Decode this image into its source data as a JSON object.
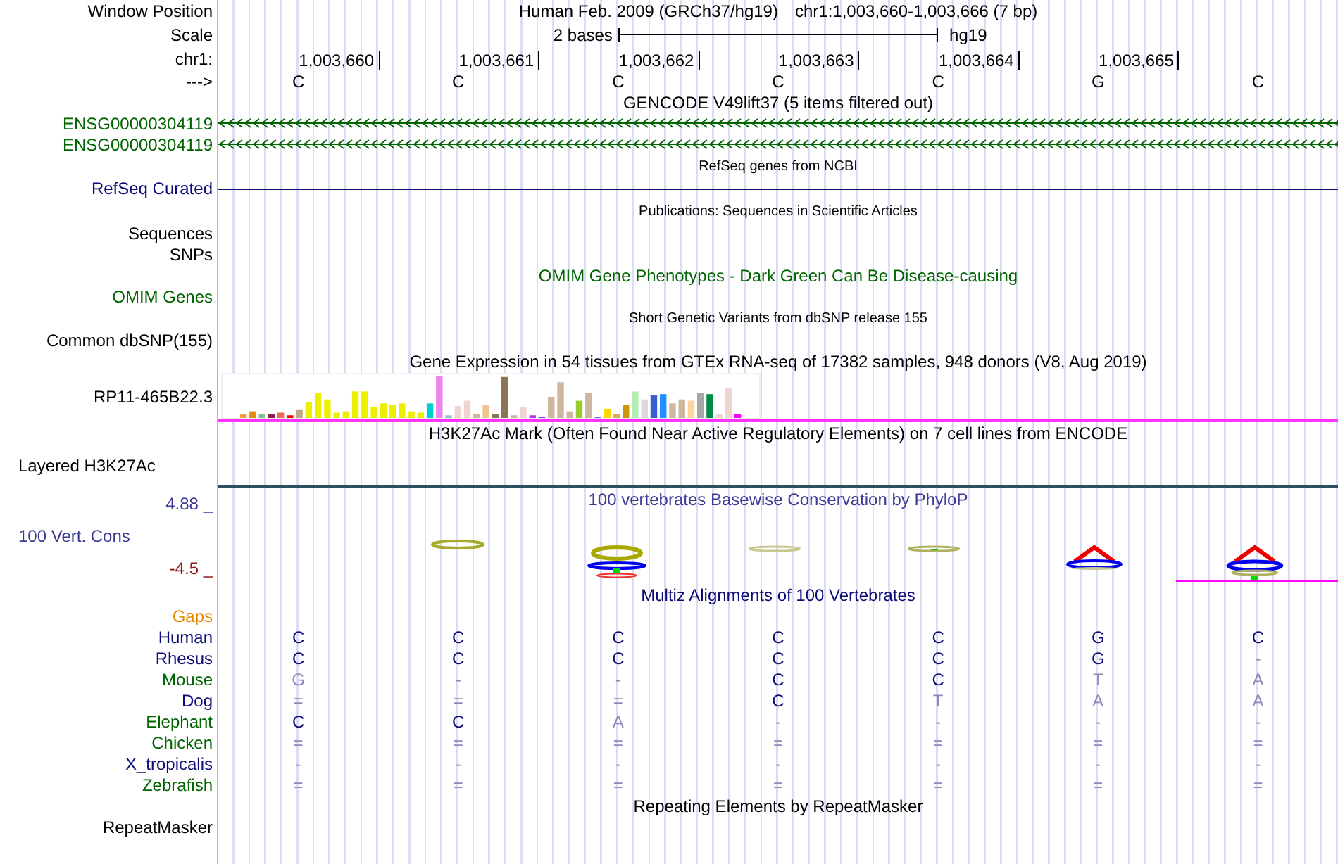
{
  "header": {
    "window_position_label": "Window Position",
    "assembly": "Human Feb. 2009 (GRCh37/hg19)",
    "position": "chr1:1,003,660-1,003,666 (7 bp)",
    "scale_label": "Scale",
    "scale_text": "2 bases",
    "scale_assembly": "hg19",
    "chrom_label": "chr1:",
    "ticks": [
      "1,003,660",
      "1,003,661",
      "1,003,662",
      "1,003,663",
      "1,003,664",
      "1,003,665"
    ],
    "strand_label": "--->",
    "bases": [
      "C",
      "C",
      "C",
      "C",
      "C",
      "G",
      "C"
    ]
  },
  "tracks": [
    {
      "kind": "title",
      "title": "GENCODE V49lift37 (5 items filtered out)",
      "color": "#000000"
    },
    {
      "kind": "gene",
      "label": "ENSG00000304119",
      "color": "#006400"
    },
    {
      "kind": "gene",
      "label": "ENSG00000304119",
      "color": "#006400"
    },
    {
      "kind": "title_small",
      "title": "RefSeq genes from NCBI",
      "color": "#000000"
    },
    {
      "kind": "line",
      "label": "RefSeq Curated",
      "color": "#0c0c78"
    },
    {
      "kind": "title_small",
      "title": "Publications: Sequences in Scientific Articles",
      "color": "#000000"
    },
    {
      "kind": "label",
      "label": "Sequences",
      "color": "#000000"
    },
    {
      "kind": "label",
      "label": "SNPs",
      "color": "#000000"
    },
    {
      "kind": "title",
      "title": "OMIM Gene Phenotypes - Dark Green Can Be Disease-causing",
      "color": "#006400"
    },
    {
      "kind": "label",
      "label": "OMIM Genes",
      "color": "#006400"
    },
    {
      "kind": "title_small",
      "title": "Short Genetic Variants from dbSNP release 155",
      "color": "#000000"
    },
    {
      "kind": "label",
      "label": "Common dbSNP(155)",
      "color": "#000000"
    },
    {
      "kind": "title",
      "title": "Gene Expression in 54 tissues from GTEx RNA-seq of 17382 samples, 948 donors (V8, Aug 2019)",
      "color": "#000000"
    },
    {
      "kind": "expression",
      "label": "RP11-465B22.3",
      "color": "#000000"
    },
    {
      "kind": "title",
      "title": "H3K27Ac Mark (Often Found Near Active Regulatory Elements) on 7 cell lines from ENCODE",
      "color": "#000000"
    },
    {
      "kind": "signal",
      "label": "Layered H3K27Ac",
      "color": "#000000"
    },
    {
      "kind": "conservation",
      "max": "4.88 _",
      "label": "100 Vert. Cons",
      "min": "-4.5 _",
      "title": "100 vertebrates Basewise Conservation by PhyloP",
      "color": "#3c3c96"
    },
    {
      "kind": "title",
      "title": "Multiz Alignments of 100 Vertebrates",
      "color": "#0c0c78"
    },
    {
      "kind": "label",
      "label": "Gaps",
      "color": "#e68a00"
    },
    {
      "kind": "alignment",
      "label": "Human",
      "color": "#0c0c78",
      "cells": [
        {
          "text": "C",
          "match": true
        },
        {
          "text": "C",
          "match": true
        },
        {
          "text": "C",
          "match": true
        },
        {
          "text": "C",
          "match": true
        },
        {
          "text": "C",
          "match": true
        },
        {
          "text": "G",
          "match": true
        },
        {
          "text": "C",
          "match": true
        }
      ]
    },
    {
      "kind": "alignment",
      "label": "Rhesus",
      "color": "#0c0c78",
      "cells": [
        {
          "text": "C",
          "match": true
        },
        {
          "text": "C",
          "match": true
        },
        {
          "text": "C",
          "match": true
        },
        {
          "text": "C",
          "match": true
        },
        {
          "text": "C",
          "match": true
        },
        {
          "text": "G",
          "match": true
        },
        {
          "text": "-",
          "match": false
        }
      ]
    },
    {
      "kind": "alignment",
      "label": "Mouse",
      "color": "#006400",
      "cells": [
        {
          "text": "G",
          "match": false
        },
        {
          "text": "-",
          "match": false
        },
        {
          "text": "-",
          "match": false
        },
        {
          "text": "C",
          "match": true
        },
        {
          "text": "C",
          "match": true
        },
        {
          "text": "T",
          "match": false
        },
        {
          "text": "A",
          "match": false
        }
      ]
    },
    {
      "kind": "alignment",
      "label": "Dog",
      "color": "#0c0c78",
      "cells": [
        {
          "text": "=",
          "match": false
        },
        {
          "text": "=",
          "match": false
        },
        {
          "text": "=",
          "match": false
        },
        {
          "text": "C",
          "match": true
        },
        {
          "text": "T",
          "match": false
        },
        {
          "text": "A",
          "match": false
        },
        {
          "text": "A",
          "match": false
        }
      ]
    },
    {
      "kind": "alignment",
      "label": "Elephant",
      "color": "#006400",
      "cells": [
        {
          "text": "C",
          "match": true
        },
        {
          "text": "C",
          "match": true
        },
        {
          "text": "A",
          "match": false
        },
        {
          "text": "-",
          "match": false
        },
        {
          "text": "-",
          "match": false
        },
        {
          "text": "-",
          "match": false
        },
        {
          "text": "-",
          "match": false
        }
      ]
    },
    {
      "kind": "alignment",
      "label": "Chicken",
      "color": "#006400",
      "cells": [
        {
          "text": "=",
          "match": false
        },
        {
          "text": "=",
          "match": false
        },
        {
          "text": "=",
          "match": false
        },
        {
          "text": "=",
          "match": false
        },
        {
          "text": "=",
          "match": false
        },
        {
          "text": "=",
          "match": false
        },
        {
          "text": "=",
          "match": false
        }
      ]
    },
    {
      "kind": "alignment",
      "label": "X_tropicalis",
      "color": "#0c0c78",
      "cells": [
        {
          "text": "-",
          "match": false
        },
        {
          "text": "-",
          "match": false
        },
        {
          "text": "-",
          "match": false
        },
        {
          "text": "-",
          "match": false
        },
        {
          "text": "-",
          "match": false
        },
        {
          "text": "-",
          "match": false
        },
        {
          "text": "-",
          "match": false
        }
      ]
    },
    {
      "kind": "alignment",
      "label": "Zebrafish",
      "color": "#006400",
      "cells": [
        {
          "text": "=",
          "match": false
        },
        {
          "text": "=",
          "match": false
        },
        {
          "text": "=",
          "match": false
        },
        {
          "text": "=",
          "match": false
        },
        {
          "text": "=",
          "match": false
        },
        {
          "text": "=",
          "match": false
        },
        {
          "text": "=",
          "match": false
        }
      ]
    },
    {
      "kind": "title",
      "title": "Repeating Elements by RepeatMasker",
      "color": "#000000"
    },
    {
      "kind": "label",
      "label": "RepeatMasker",
      "color": "#000000"
    }
  ]
}
